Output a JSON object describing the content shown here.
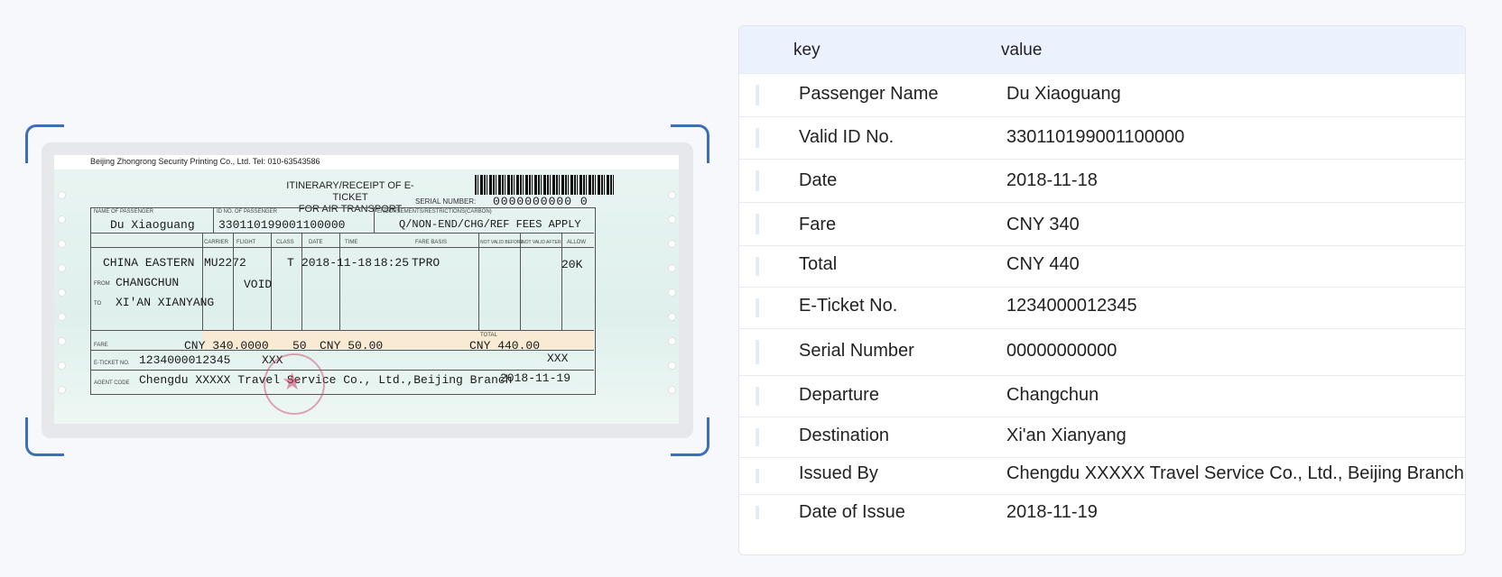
{
  "ticket": {
    "printer": "Beijing Zhongrong Security Printing Co., Ltd.  Tel: 010-63543586",
    "title_line1": "ITINERARY/RECEIPT OF E-TICKET",
    "title_line2": "FOR AIR TRANSPORT",
    "serial_label": "SERIAL NUMBER:",
    "serial_value": "0000000000 0",
    "label_name": "NAME OF PASSENGER",
    "label_id": "ID NO. OF PASSENGER",
    "label_endorse": "ENDORSEMENTS/RESTRICTIONS(CARBON)",
    "passenger_name": "Du Xiaoguang",
    "id_no": "330110199001100000",
    "endorsements": "Q/NON-END/CHG/REF FEES APPLY",
    "col_carrier": "CARRIER",
    "col_flight": "FLIGHT",
    "col_class": "CLASS",
    "col_date": "DATE",
    "col_time": "TIME",
    "col_fare_basis": "FARE BASIS",
    "col_not_before": "NOT VALID BEFORE",
    "col_not_after": "NOT VALID AFTER",
    "col_allow": "ALLOW",
    "carrier": "CHINA EASTERN",
    "flight": "MU2272",
    "class": "T",
    "date": "2018-11-18",
    "time": "18:25",
    "fare_basis": "TPRO",
    "allow": "20K",
    "from_label": "FROM",
    "from": "CHANGCHUN",
    "void": "VOID",
    "to_label": "TO",
    "to": "XI'AN XIANYANG",
    "fare_label": "FARE",
    "fare": "CNY  340.0000",
    "fuel": "50",
    "tax": "CNY    50.00",
    "total_label": "TOTAL",
    "total": "CNY  440.00",
    "eticket_label": "E-TICKET NO.",
    "eticket": "1234000012345",
    "xxx1": "XXX",
    "xxx2": "XXX",
    "agent_label": "AGENT CODE",
    "issued_by": "Chengdu XXXXX Travel Service Co., Ltd.,Beijing Branch",
    "date_of_issue": "2018-11-19"
  },
  "table": {
    "header_key": "key",
    "header_value": "value",
    "rows": [
      {
        "key": "Passenger Name",
        "value": "Du Xiaoguang"
      },
      {
        "key": "Valid ID No.",
        "value": "330110199001100000"
      },
      {
        "key": "Date",
        "value": "2018-11-18"
      },
      {
        "key": "Fare",
        "value": "CNY 340"
      },
      {
        "key": "Total",
        "value": "CNY 440"
      },
      {
        "key": "E-Ticket No.",
        "value": "1234000012345"
      },
      {
        "key": "Serial Number",
        "value": "00000000000"
      },
      {
        "key": "Departure",
        "value": "Changchun"
      },
      {
        "key": "Destination",
        "value": "Xi'an Xianyang"
      },
      {
        "key": "Issued By",
        "value": "Chengdu XXXXX Travel Service Co., Ltd., Beijing Branch"
      },
      {
        "key": "Date of Issue",
        "value": "2018-11-19"
      }
    ]
  },
  "colors": {
    "accent": "#3d6fb8",
    "header_bg": "#ebf2fd"
  }
}
